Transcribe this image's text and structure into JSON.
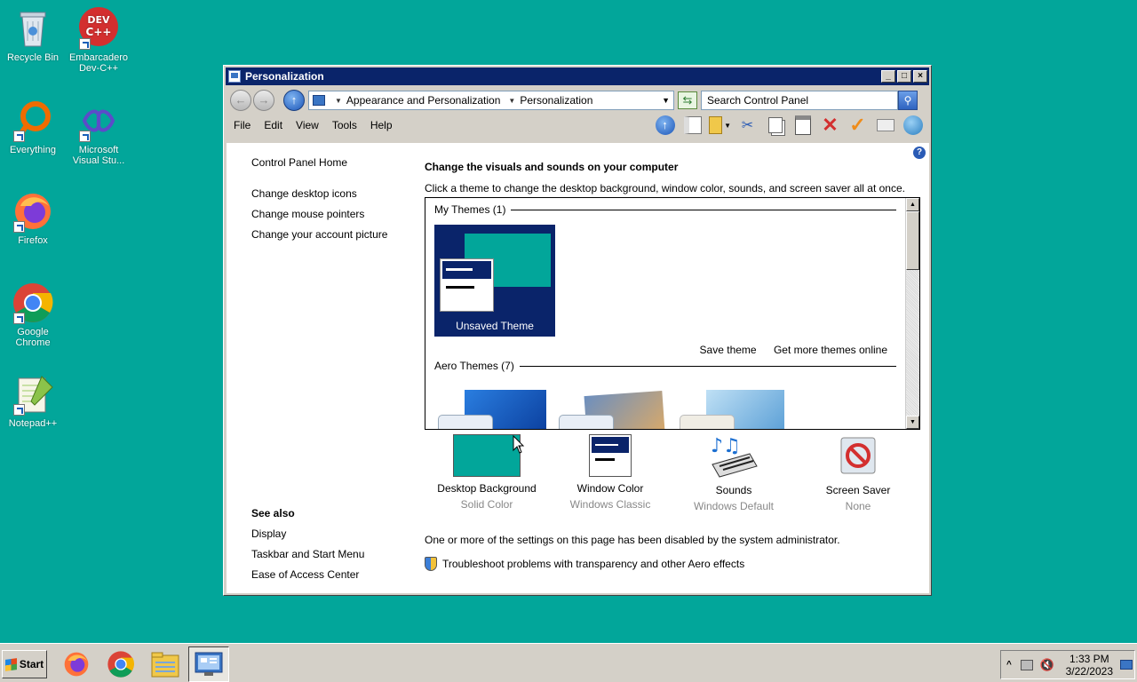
{
  "desktop": {
    "icons": [
      {
        "label": "Recycle Bin"
      },
      {
        "label": "Embarcadero Dev-C++"
      },
      {
        "label": "Everything"
      },
      {
        "label": "Microsoft Visual Stu..."
      },
      {
        "label": "Firefox"
      },
      {
        "label": "Google Chrome"
      },
      {
        "label": "Notepad++"
      }
    ],
    "background_color": "#02a69a"
  },
  "window": {
    "title": "Personalization",
    "address": {
      "crumbs": [
        "Appearance and Personalization",
        "Personalization"
      ]
    },
    "search": {
      "placeholder": "Search Control Panel"
    },
    "menu": [
      "File",
      "Edit",
      "View",
      "Tools",
      "Help"
    ],
    "left_pane": {
      "home_link": "Control Panel Home",
      "links": [
        "Change desktop icons",
        "Change mouse pointers",
        "Change your account picture"
      ],
      "see_also_title": "See also",
      "see_also": [
        "Display",
        "Taskbar and Start Menu",
        "Ease of Access Center"
      ]
    },
    "main": {
      "heading": "Change the visuals and sounds on your computer",
      "subheading": "Click a theme to change the desktop background, window color, sounds, and screen saver all at once.",
      "my_themes_label": "My Themes (1)",
      "unsaved_theme_label": "Unsaved Theme",
      "save_theme": "Save theme",
      "get_more_themes": "Get more themes online",
      "aero_themes_label": "Aero Themes (7)",
      "settings": [
        {
          "name": "Desktop Background",
          "value": "Solid Color"
        },
        {
          "name": "Window Color",
          "value": "Windows Classic"
        },
        {
          "name": "Sounds",
          "value": "Windows Default"
        },
        {
          "name": "Screen Saver",
          "value": "None"
        }
      ],
      "disabled_message": "One or more of the settings on this page has been disabled by the system administrator.",
      "troubleshoot_link": "Troubleshoot problems with transparency and other Aero effects"
    }
  },
  "taskbar": {
    "start_label": "Start",
    "clock_time": "1:33 PM",
    "clock_date": "3/22/2023"
  }
}
